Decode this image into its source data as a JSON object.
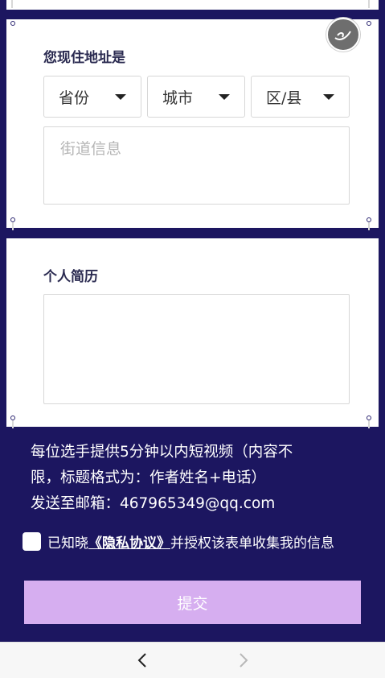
{
  "address": {
    "title": "您现住地址是",
    "province": "省份",
    "city": "城市",
    "district": "区/县",
    "street_placeholder": "街道信息"
  },
  "resume": {
    "title": "个人简历"
  },
  "info": {
    "line1": "每位选手提供5分钟以内短视频（内容不",
    "line2": "限，标题格式为：作者姓名+电话）",
    "line3": "发送至邮箱：467965349@qq.com"
  },
  "consent": {
    "prefix": "已知晓",
    "link": "《隐私协议》",
    "suffix": "并授权该表单收集我的信息"
  },
  "submit_label": "提交",
  "colors": {
    "background": "#1c1660",
    "submit": "#d6aef0"
  },
  "icons": {
    "logo": "brand-logo-icon",
    "back": "chevron-left-icon",
    "forward": "chevron-right-icon"
  }
}
